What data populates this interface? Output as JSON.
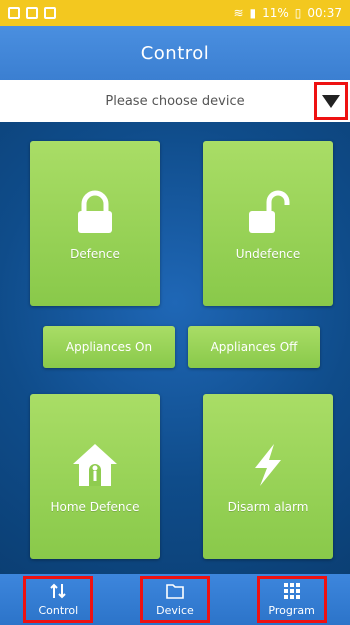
{
  "status_bar": {
    "battery_text": "11%",
    "time": "00:37"
  },
  "header": {
    "title": "Control"
  },
  "device_select": {
    "placeholder": "Please choose device"
  },
  "tiles": {
    "defence": "Defence",
    "undefence": "Undefence",
    "appliances_on": "Appliances On",
    "appliances_off": "Appliances Off",
    "home_defence": "Home Defence",
    "disarm_alarm": "Disarm alarm"
  },
  "bottom_nav": {
    "control": "Control",
    "device": "Device",
    "program": "Program"
  },
  "colors": {
    "status_bar": "#f3c81f",
    "header": "#3b7fd1",
    "tile_green": "#9ad35a",
    "background": "#0f4c8a",
    "highlight_red": "#e11111"
  }
}
